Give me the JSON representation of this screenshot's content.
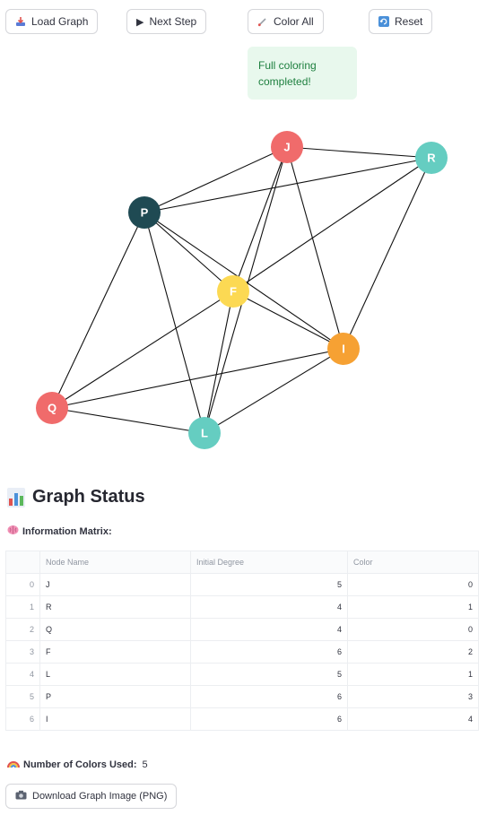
{
  "toolbar": {
    "load_label": "Load Graph",
    "next_label": "Next Step",
    "color_label": "Color All",
    "reset_label": "Reset"
  },
  "alert": {
    "message": "Full coloring completed!"
  },
  "graph": {
    "palette": [
      "#f06b6b",
      "#65cdc1",
      "#fcd953",
      "#f6a133",
      "#1f4a53"
    ],
    "nodes": [
      {
        "name": "J",
        "color": 0
      },
      {
        "name": "R",
        "color": 1
      },
      {
        "name": "P",
        "color": 4
      },
      {
        "name": "F",
        "color": 2
      },
      {
        "name": "I",
        "color": 3
      },
      {
        "name": "Q",
        "color": 0
      },
      {
        "name": "L",
        "color": 1
      }
    ],
    "edges": [
      [
        "J",
        "R"
      ],
      [
        "J",
        "P"
      ],
      [
        "J",
        "F"
      ],
      [
        "J",
        "I"
      ],
      [
        "J",
        "L"
      ],
      [
        "R",
        "P"
      ],
      [
        "R",
        "F"
      ],
      [
        "R",
        "I"
      ],
      [
        "P",
        "F"
      ],
      [
        "P",
        "I"
      ],
      [
        "P",
        "Q"
      ],
      [
        "P",
        "L"
      ],
      [
        "F",
        "Q"
      ],
      [
        "F",
        "L"
      ],
      [
        "F",
        "I"
      ],
      [
        "I",
        "Q"
      ],
      [
        "I",
        "L"
      ],
      [
        "Q",
        "L"
      ]
    ]
  },
  "status": {
    "title": "Graph Status",
    "matrix_label": "Information Matrix:",
    "columns": [
      "Node Name",
      "Initial Degree",
      "Color"
    ],
    "rows": [
      {
        "index": "0",
        "name": "J",
        "degree": "5",
        "color": "0"
      },
      {
        "index": "1",
        "name": "R",
        "degree": "4",
        "color": "1"
      },
      {
        "index": "2",
        "name": "Q",
        "degree": "4",
        "color": "0"
      },
      {
        "index": "3",
        "name": "F",
        "degree": "6",
        "color": "2"
      },
      {
        "index": "4",
        "name": "L",
        "degree": "5",
        "color": "1"
      },
      {
        "index": "5",
        "name": "P",
        "degree": "6",
        "color": "3"
      },
      {
        "index": "6",
        "name": "I",
        "degree": "6",
        "color": "4"
      }
    ],
    "colors_used_label": "Number of Colors Used:",
    "colors_used_value": "5",
    "download_label": "Download Graph Image (PNG)"
  }
}
